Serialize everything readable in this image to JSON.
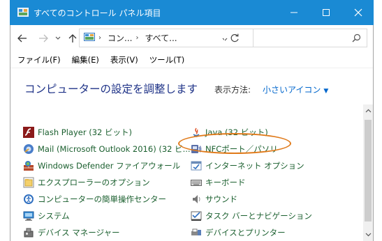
{
  "window": {
    "title": "すべてのコントロール パネル項目",
    "minimize": "—",
    "maximize": "☐",
    "close": "✕"
  },
  "nav": {
    "back": "←",
    "forward": "→",
    "recent": "⌄",
    "up": "↑",
    "breadcrumb": [
      "コン...",
      "すべて..."
    ],
    "address_dropdown": "⌄",
    "refresh": "↻",
    "search_placeholder": ""
  },
  "menu": [
    "ファイル(F)",
    "編集(E)",
    "表示(V)",
    "ツール(T)"
  ],
  "page": {
    "heading": "コンピューターの設定を調整します",
    "view_by_label": "表示方法:",
    "view_by_value": "小さいアイコン",
    "view_by_arrow": "▼"
  },
  "items_left": [
    {
      "label": "Flash Player (32 ビット)",
      "icon": "flash-icon"
    },
    {
      "label": "Mail (Microsoft Outlook 2016) (32 ビ...",
      "icon": "mail-icon"
    },
    {
      "label": "Windows Defender ファイアウォール",
      "icon": "firewall-icon"
    },
    {
      "label": "エクスプローラーのオプション",
      "icon": "folder-options-icon"
    },
    {
      "label": "コンピューターの簡単操作センター",
      "icon": "ease-of-access-icon"
    },
    {
      "label": "システム",
      "icon": "system-icon"
    },
    {
      "label": "デバイス マネージャー",
      "icon": "device-manager-icon"
    }
  ],
  "items_right": [
    {
      "label": "Java (32 ビット)",
      "icon": "java-icon"
    },
    {
      "label": "NFCポート／パソリ",
      "icon": "nfc-icon"
    },
    {
      "label": "インターネット オプション",
      "icon": "internet-options-icon"
    },
    {
      "label": "キーボード",
      "icon": "keyboard-icon"
    },
    {
      "label": "サウンド",
      "icon": "sound-icon"
    },
    {
      "label": "タスク バーとナビゲーション",
      "icon": "taskbar-icon"
    },
    {
      "label": "デバイスとプリンター",
      "icon": "printer-icon"
    }
  ],
  "scroll": {
    "up": "^",
    "down": "⌄"
  },
  "colors": {
    "titlebar": "#1a8ad4",
    "link": "#1a5f2e",
    "heading": "#1e3287",
    "highlight": "#e07a1a"
  }
}
